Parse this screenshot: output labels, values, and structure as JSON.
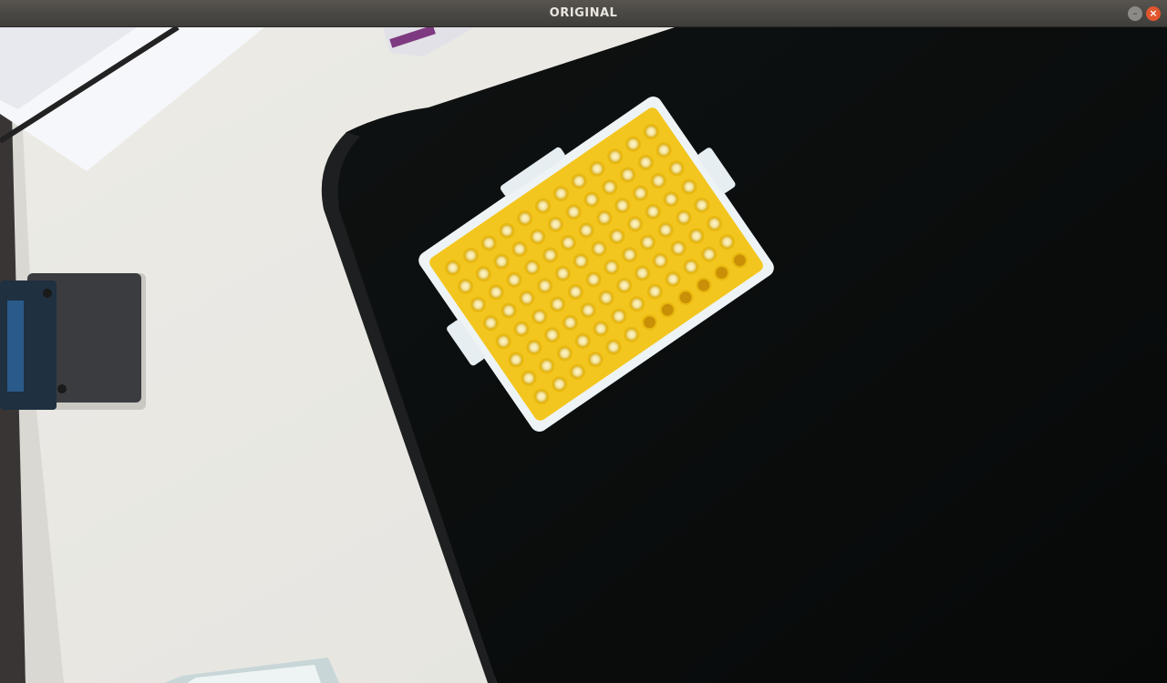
{
  "window": {
    "title": "ORIGINAL",
    "minimize_glyph": "–",
    "close_glyph": "×"
  },
  "image_view": {
    "plate": {
      "color": "#f3c61f",
      "rows": 8,
      "columns": 12,
      "empty_wells": 6
    }
  }
}
